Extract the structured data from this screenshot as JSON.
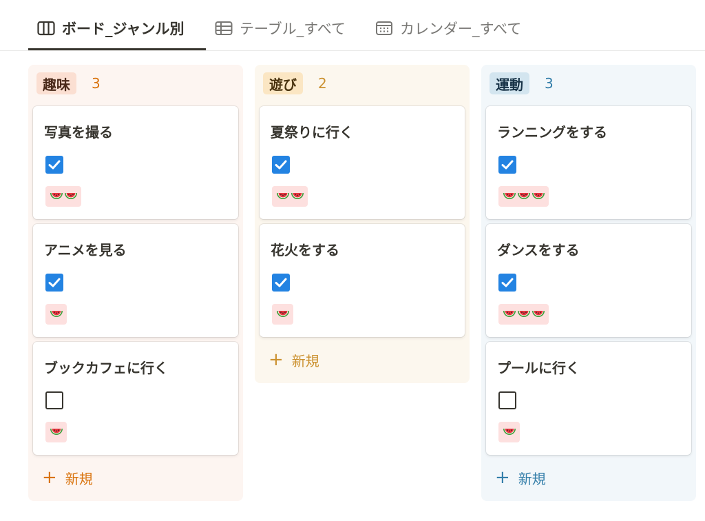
{
  "tabs": [
    {
      "label": "ボード_ジャンル別",
      "icon": "board-icon",
      "active": true
    },
    {
      "label": "テーブル_すべて",
      "icon": "table-icon",
      "active": false
    },
    {
      "label": "カレンダー_すべて",
      "icon": "calendar-icon",
      "active": false
    }
  ],
  "columns": [
    {
      "name": "趣味",
      "count": "3",
      "pill_bg": "#fbdfd2",
      "pill_color": "#4a2a1a",
      "col_bg": "#fdf5f1",
      "accent": "#d9730d",
      "cards": [
        {
          "title": "写真を撮る",
          "checked": true,
          "watermelons": 2
        },
        {
          "title": "アニメを見る",
          "checked": true,
          "watermelons": 1
        },
        {
          "title": "ブックカフェに行く",
          "checked": false,
          "watermelons": 1
        }
      ],
      "new_label": "新規"
    },
    {
      "name": "遊び",
      "count": "2",
      "pill_bg": "#fbe6c3",
      "pill_color": "#4a3410",
      "col_bg": "#fcf7ee",
      "accent": "#cb912f",
      "cards": [
        {
          "title": "夏祭りに行く",
          "checked": true,
          "watermelons": 2
        },
        {
          "title": "花火をする",
          "checked": true,
          "watermelons": 1
        }
      ],
      "new_label": "新規"
    },
    {
      "name": "運動",
      "count": "3",
      "pill_bg": "#d3e5ef",
      "pill_color": "#183347",
      "col_bg": "#f2f7fa",
      "accent": "#337ea9",
      "cards": [
        {
          "title": "ランニングをする",
          "checked": true,
          "watermelons": 3
        },
        {
          "title": "ダンスをする",
          "checked": true,
          "watermelons": 3
        },
        {
          "title": "プールに行く",
          "checked": false,
          "watermelons": 1
        }
      ],
      "new_label": "新規"
    }
  ]
}
